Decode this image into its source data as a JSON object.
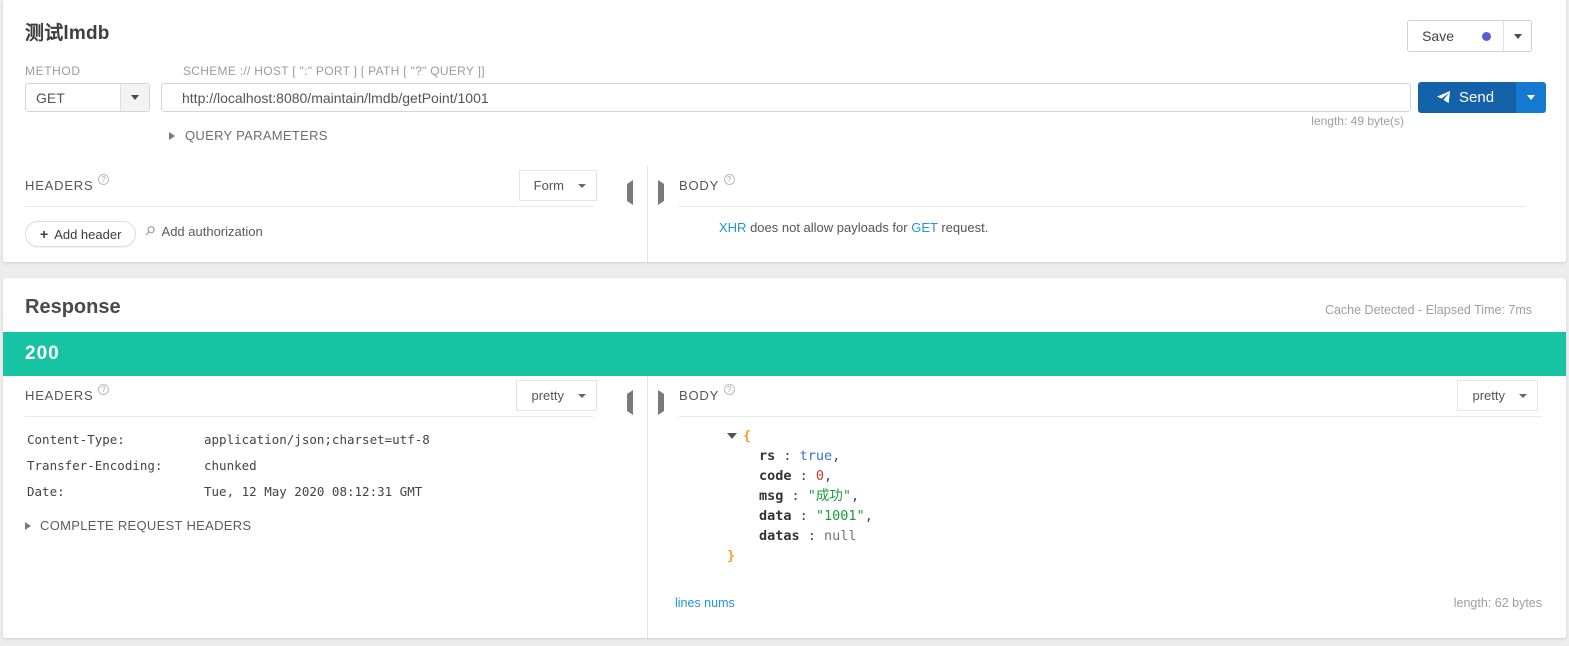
{
  "request": {
    "title": "测试lmdb",
    "save": {
      "label": "Save",
      "dot_color": "#5b5bd1"
    },
    "method_label": "METHOD",
    "method_value": "GET",
    "scheme_label": "SCHEME :// HOST [ \":\" PORT ] [ PATH [ \"?\" QUERY ]]",
    "url_value": "http://localhost:8080/maintain/lmdb/getPoint/1001",
    "url_placeholder": "http://",
    "send_label": "Send",
    "length_text": "length: 49 byte(s)",
    "query_parameters_label": "QUERY PARAMETERS",
    "headers": {
      "section_label": "HEADERS",
      "view_mode": "Form",
      "add_header_label": "Add header",
      "add_authorization_label": "Add authorization"
    },
    "body": {
      "section_label": "BODY",
      "note_prefix": "XHR",
      "note_middle": " does not allow payloads for ",
      "note_method": "GET",
      "note_suffix": " request."
    }
  },
  "response": {
    "title": "Response",
    "cache_info": "Cache Detected - Elapsed Time: 7ms",
    "status_code": "200",
    "status_color": "#16c3a2",
    "headers": {
      "section_label": "HEADERS",
      "view_mode": "pretty",
      "rows": [
        {
          "key": "Content-Type:",
          "value": "application/json;charset=utf-8"
        },
        {
          "key": "Transfer-Encoding:",
          "value": "chunked"
        },
        {
          "key": "Date:",
          "value": "Tue, 12 May 2020 08:12:31 GMT"
        }
      ],
      "complete_request_headers_label": "COMPLETE REQUEST HEADERS"
    },
    "body": {
      "section_label": "BODY",
      "view_mode": "pretty",
      "json": {
        "open_brace": "{",
        "close_brace": "}",
        "fields": [
          {
            "key": "rs",
            "sep": " : ",
            "value": "true",
            "type": "bool",
            "comma": ","
          },
          {
            "key": "code",
            "sep": " : ",
            "value": "0",
            "type": "num",
            "comma": ","
          },
          {
            "key": "msg",
            "sep": " : ",
            "value": "\"成功\"",
            "type": "str",
            "comma": ","
          },
          {
            "key": "data",
            "sep": " : ",
            "value": "\"1001\"",
            "type": "str",
            "comma": ","
          },
          {
            "key": "datas",
            "sep": " : ",
            "value": "null",
            "type": "null",
            "comma": ""
          }
        ]
      },
      "lines_nums_label": "lines nums",
      "length_text": "length: 62 bytes"
    }
  }
}
